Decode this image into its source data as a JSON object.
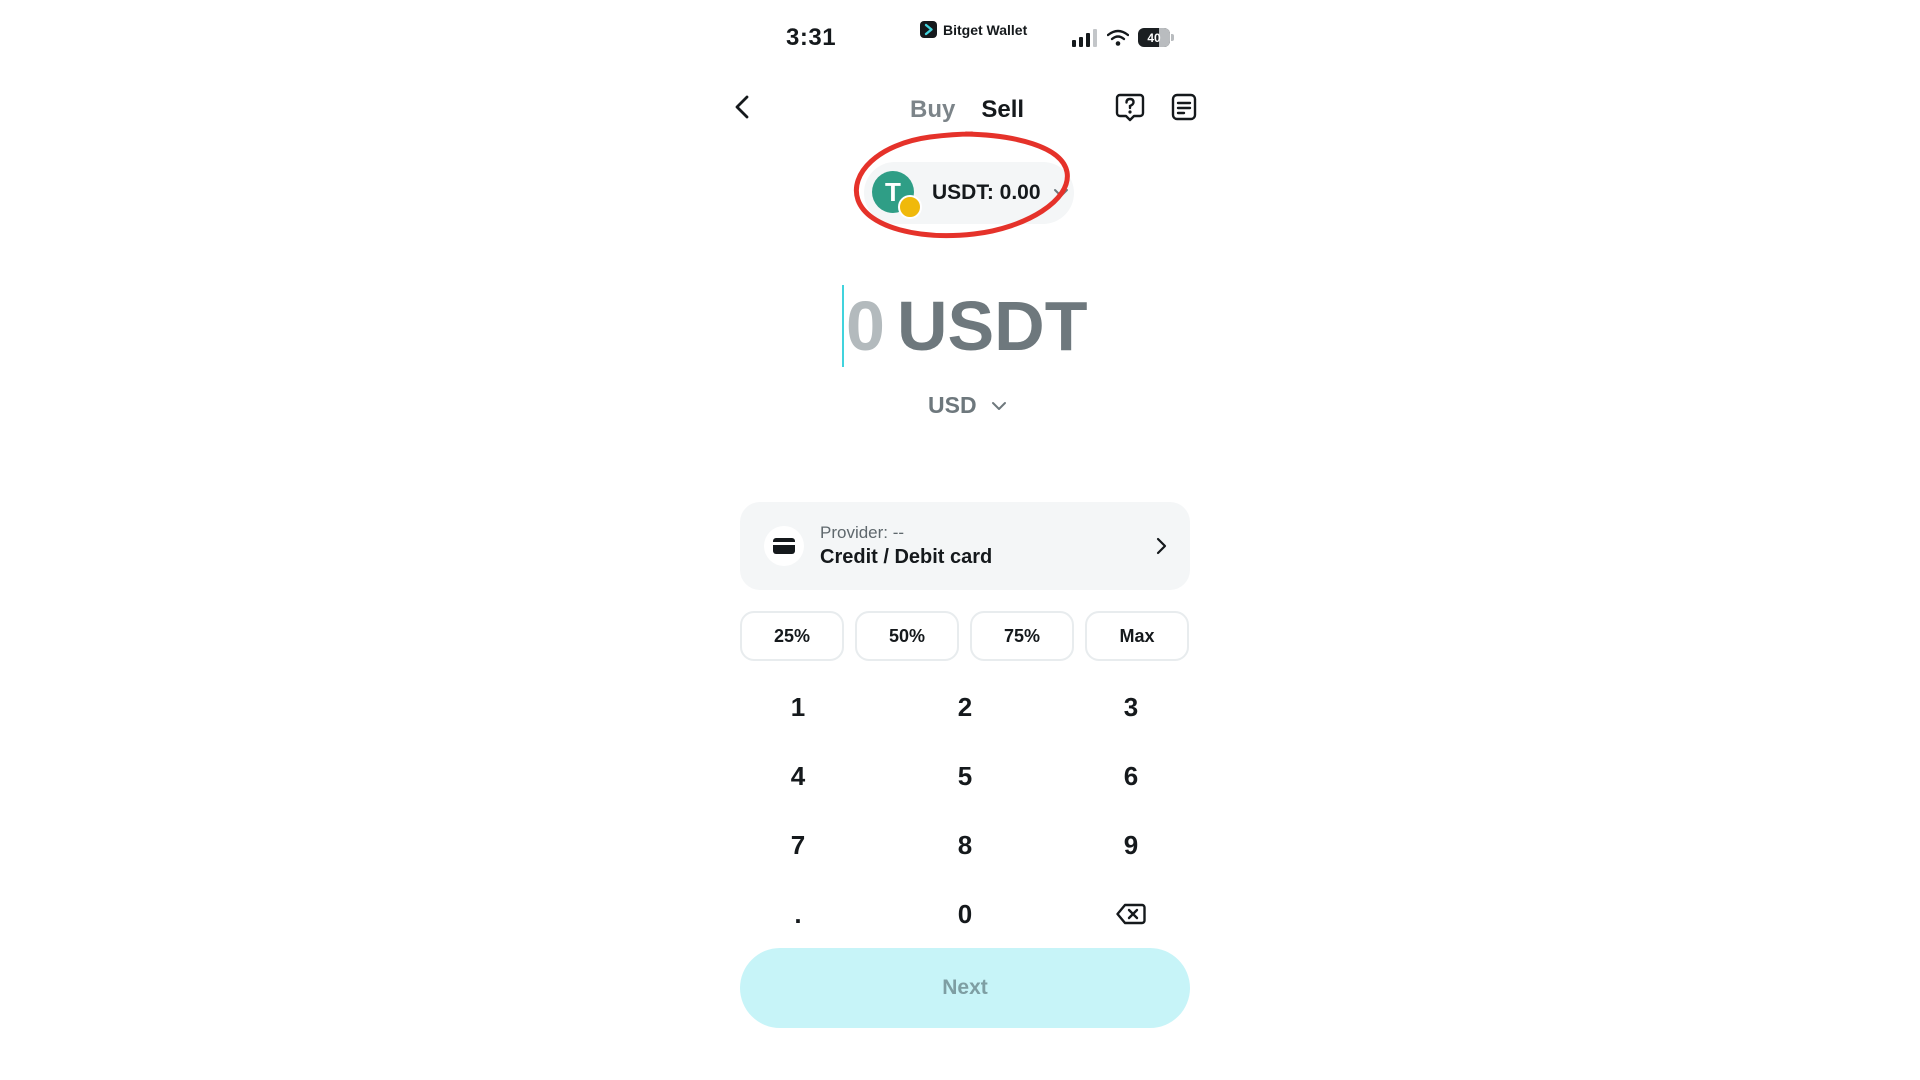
{
  "status_bar": {
    "time": "3:31",
    "brand": "Bitget Wallet",
    "battery": "40"
  },
  "header": {
    "tabs": [
      {
        "label": "Buy",
        "active": false
      },
      {
        "label": "Sell",
        "active": true
      }
    ],
    "icons": [
      "back-icon",
      "help-icon",
      "order-history-icon"
    ]
  },
  "token_selector": {
    "label": "USDT: 0.00",
    "token_icon": "T"
  },
  "amount": {
    "value": "0",
    "unit": "USDT"
  },
  "fiat": {
    "currency": "USD"
  },
  "provider": {
    "label": "Provider: --",
    "method": "Credit / Debit card"
  },
  "percent_buttons": [
    "25%",
    "50%",
    "75%",
    "Max"
  ],
  "keypad": {
    "keys": [
      "1",
      "2",
      "3",
      "4",
      "5",
      "6",
      "7",
      "8",
      "9",
      ".",
      "0"
    ]
  },
  "next_button": {
    "label": "Next"
  },
  "colors": {
    "accent": "#c7f4f8",
    "annotation": "#e5322a",
    "token": "#2f9e86",
    "chain_badge": "#f0b90b"
  }
}
